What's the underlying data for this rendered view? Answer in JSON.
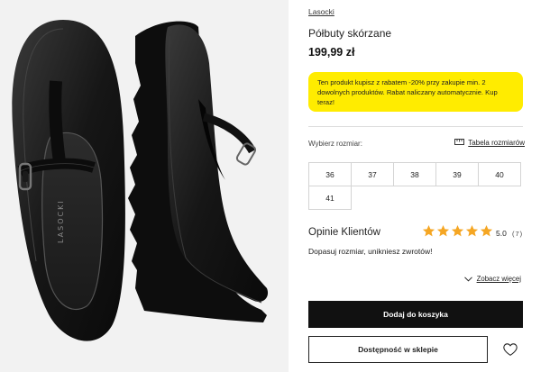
{
  "product": {
    "brand": "Lasocki",
    "title": "Półbuty skórzane",
    "price": "199,99 zł",
    "image_brand_mark": "LASOCKI"
  },
  "promo": {
    "text": "Ten produkt kupisz z rabatem -20% przy zakupie min. 2 dowolnych produktów. Rabat naliczany automatycznie. Kup teraz!",
    "color": "#ffec00"
  },
  "sizes": {
    "label": "Wybierz rozmiar:",
    "chart_link": "Tabela rozmiarów",
    "chart_icon": "ruler-icon",
    "options": [
      "36",
      "37",
      "38",
      "39",
      "40",
      "41"
    ]
  },
  "reviews": {
    "title": "Opinie Klientów",
    "rating": "5.0",
    "count": "(7)",
    "stars": 5,
    "star_color": "#f5a623",
    "fit_text": "Dopasuj rozmiar, unikniesz zwrotów!",
    "see_more": "Zobacz więcej"
  },
  "actions": {
    "add_to_cart": "Dodaj do koszyka",
    "availability": "Dostępność w sklepie",
    "wishlist_icon": "heart-icon"
  }
}
